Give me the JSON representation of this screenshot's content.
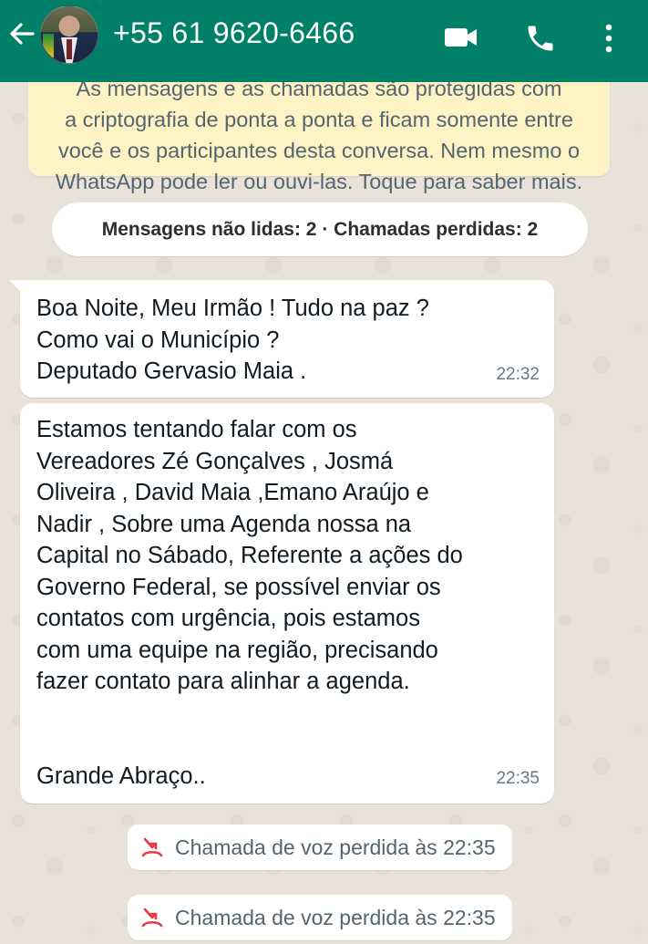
{
  "header": {
    "contact": "+55 61 9620-6466",
    "icons": [
      "back-arrow-icon",
      "video-call-icon",
      "phone-call-icon",
      "more-options-icon"
    ],
    "bar_color": "#008069"
  },
  "e2e_notice": {
    "lines": [
      "As mensagens e as chamadas são protegidas com",
      "a criptografia de ponta a ponta e ficam somente entre",
      "você e os participantes desta conversa. Nem mesmo o",
      "WhatsApp pode ler ou ouvi-las. Toque para saber mais."
    ]
  },
  "unread_banner": {
    "text": "Mensagens não lidas: 2 · Chamadas perdidas: 2"
  },
  "messages": [
    {
      "lines": [
        "Boa Noite, Meu Irmão ! Tudo na paz ?",
        "Como vai o Município ?",
        "Deputado Gervasio Maia ."
      ],
      "time": "22:32"
    },
    {
      "lines": [
        "Estamos tentando falar com os",
        "Vereadores Zé Gonçalves , Josmá",
        "Oliveira , David Maia ,Emano Araújo e",
        "Nadir , Sobre uma Agenda nossa na",
        "Capital no Sábado, Referente a ações do",
        "Governo Federal, se possível enviar os",
        "contatos com urgência, pois estamos",
        "com uma equipe na região, precisando",
        "fazer contato para alinhar a agenda."
      ],
      "closing": "Grande Abraço..",
      "time": "22:35"
    }
  ],
  "missed_calls": [
    {
      "text": "Chamada de voz perdida às 22:35",
      "icon": "missed-call-icon",
      "icon_color": "#e53945"
    },
    {
      "text": "Chamada de voz perdida às 22:35",
      "icon": "missed-call-icon",
      "icon_color": "#e53945"
    }
  ]
}
